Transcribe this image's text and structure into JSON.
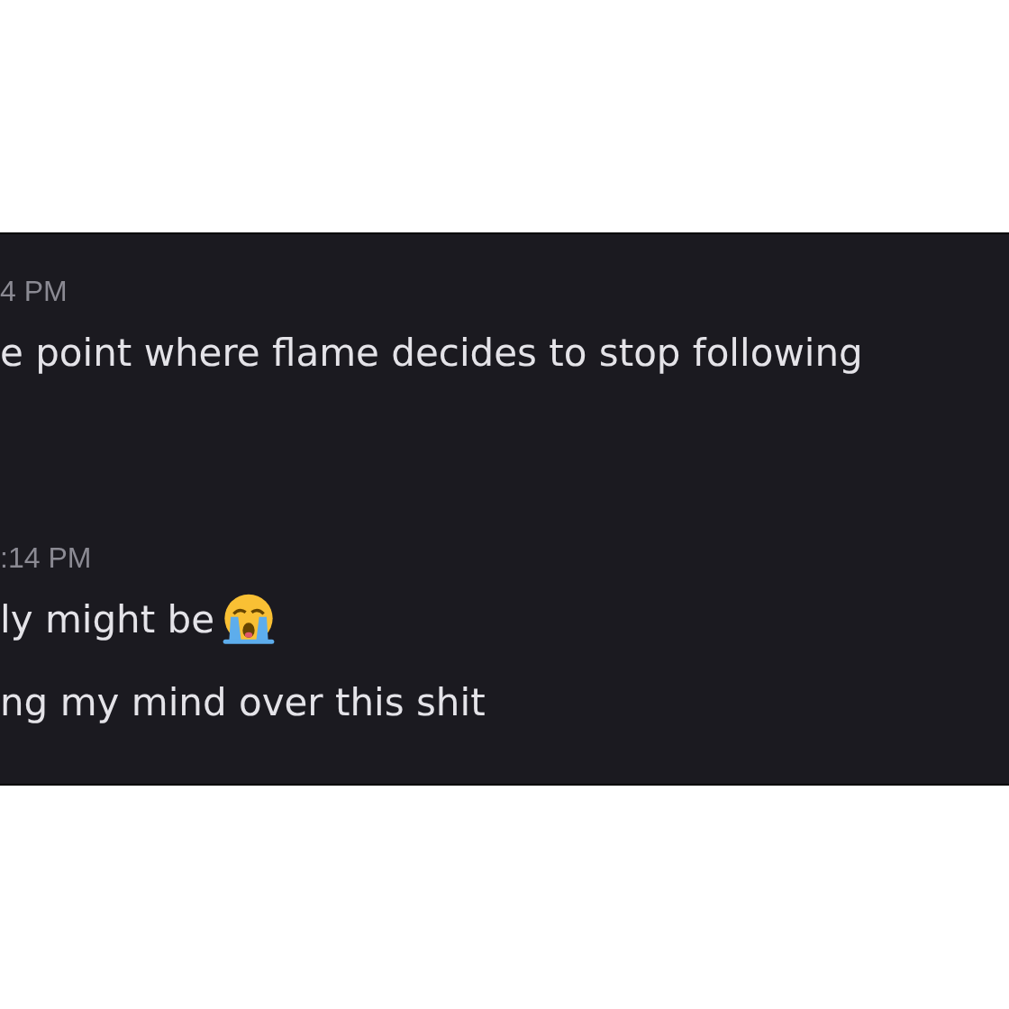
{
  "messages": [
    {
      "timestamp": "4 PM",
      "lines": [
        {
          "text": "e point where flame decides to stop following",
          "emoji": false
        }
      ]
    },
    {
      "timestamp": ":14 PM",
      "lines": [
        {
          "text": "ly might be",
          "emoji": true
        },
        {
          "text": "ng my mind over this shit",
          "emoji": false
        }
      ]
    }
  ]
}
